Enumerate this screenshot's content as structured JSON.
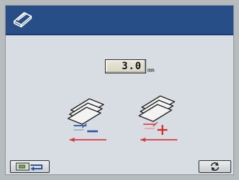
{
  "header": {
    "icon": "book-stack-icon",
    "background_color": "#274e86"
  },
  "setting": {
    "value": "3.0",
    "unit": "mm"
  },
  "options": [
    {
      "name": "decrease-option",
      "symbol": "minus",
      "arrow_color": "#d63a3a"
    },
    {
      "name": "increase-option",
      "symbol": "plus",
      "arrow_color": "#d63a3a"
    }
  ],
  "footer": {
    "back_icon": "return-arrow-icon",
    "refresh_icon": "refresh-icon"
  }
}
